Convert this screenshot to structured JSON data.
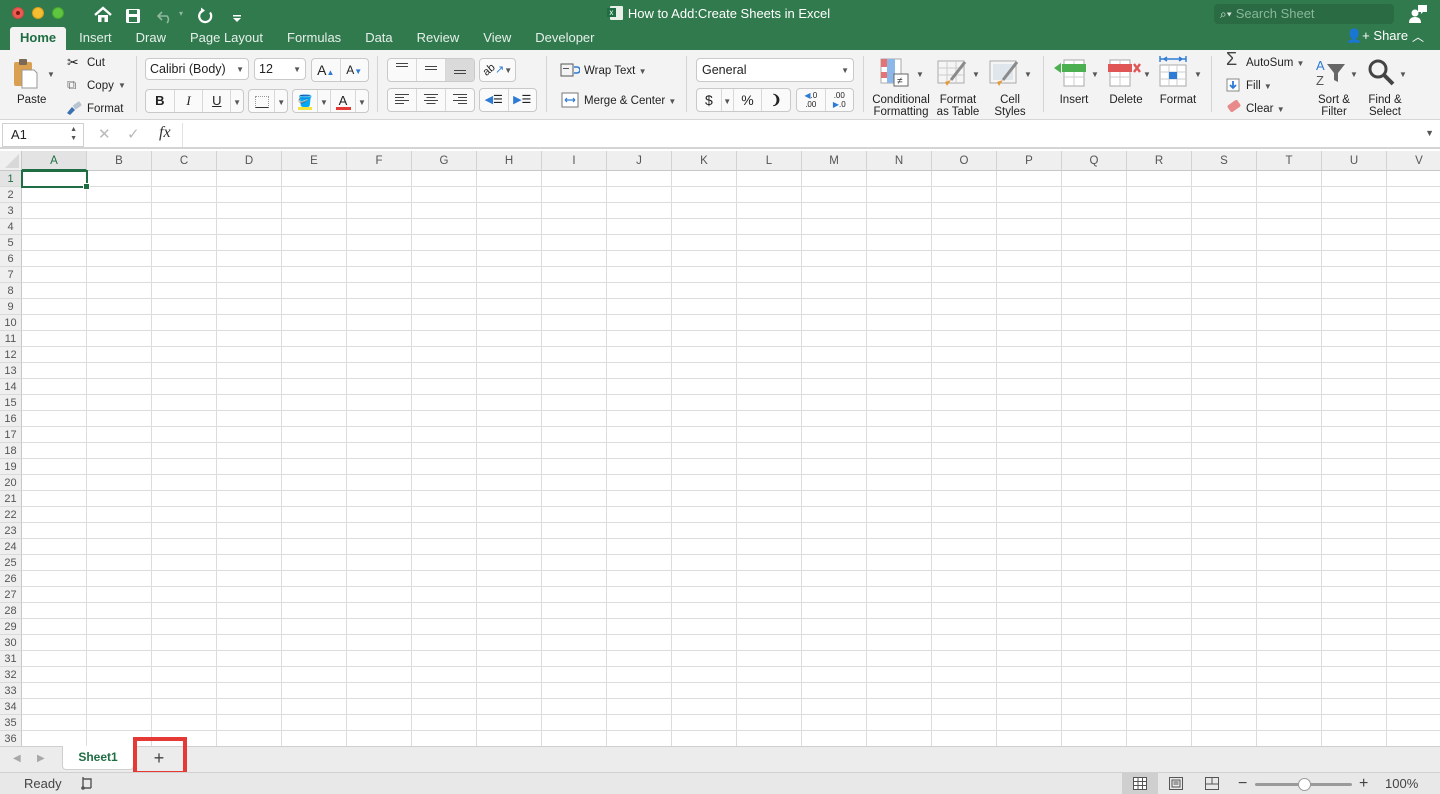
{
  "window": {
    "title": "How to Add:Create Sheets in Excel",
    "search_placeholder": "Search Sheet",
    "share_label": "Share"
  },
  "quick_access": [
    "home-icon",
    "save-icon",
    "undo-icon",
    "redo-icon",
    "customize-icon"
  ],
  "tabs": [
    {
      "label": "Home",
      "active": true
    },
    {
      "label": "Insert"
    },
    {
      "label": "Draw"
    },
    {
      "label": "Page Layout"
    },
    {
      "label": "Formulas"
    },
    {
      "label": "Data"
    },
    {
      "label": "Review"
    },
    {
      "label": "View"
    },
    {
      "label": "Developer"
    }
  ],
  "ribbon": {
    "clipboard": {
      "paste": "Paste",
      "cut": "Cut",
      "copy": "Copy",
      "format": "Format"
    },
    "font": {
      "name": "Calibri (Body)",
      "size": "12",
      "bold": "B",
      "italic": "I",
      "underline": "U",
      "grow": "A",
      "shrink": "A",
      "font_color_letter": "A"
    },
    "alignment": {
      "wrap_text": "Wrap Text",
      "merge_center": "Merge & Center"
    },
    "number": {
      "format": "General",
      "currency": "$",
      "percent": "%",
      "comma": "❩",
      "inc_decimal": ".0\n.00",
      "dec_decimal": ".00\n.0"
    },
    "styles": {
      "conditional_1": "Conditional",
      "conditional_2": "Formatting",
      "format_table_1": "Format",
      "format_table_2": "as Table",
      "cell_styles_1": "Cell",
      "cell_styles_2": "Styles"
    },
    "cells": {
      "insert": "Insert",
      "delete": "Delete",
      "format": "Format"
    },
    "editing": {
      "autosum": "AutoSum",
      "fill": "Fill",
      "clear": "Clear",
      "sort_1": "Sort &",
      "sort_2": "Filter",
      "find_1": "Find &",
      "find_2": "Select"
    }
  },
  "formula_bar": {
    "name_box": "A1",
    "fx": "fx",
    "value": ""
  },
  "grid": {
    "columns": [
      "A",
      "B",
      "C",
      "D",
      "E",
      "F",
      "G",
      "H",
      "I",
      "J",
      "K",
      "L",
      "M",
      "N",
      "O",
      "P",
      "Q",
      "R",
      "S",
      "T",
      "U",
      "V"
    ],
    "rows": [
      "1",
      "2",
      "3",
      "4",
      "5",
      "6",
      "7",
      "8",
      "9",
      "10",
      "11",
      "12",
      "13",
      "14",
      "15",
      "16",
      "17",
      "18",
      "19",
      "20",
      "21",
      "22",
      "23",
      "24",
      "25",
      "26",
      "27",
      "28",
      "29",
      "30",
      "31",
      "32",
      "33",
      "34",
      "35",
      "36"
    ],
    "active_cell": "A1"
  },
  "sheets": {
    "tabs": [
      "Sheet1"
    ],
    "active": "Sheet1",
    "add_label": "+"
  },
  "status": {
    "mode": "Ready",
    "zoom": "100%",
    "zoom_level_percent": 100
  },
  "colors": {
    "brand": "#317a4e",
    "accent": "#1f6e43",
    "highlight": "#e53935"
  }
}
